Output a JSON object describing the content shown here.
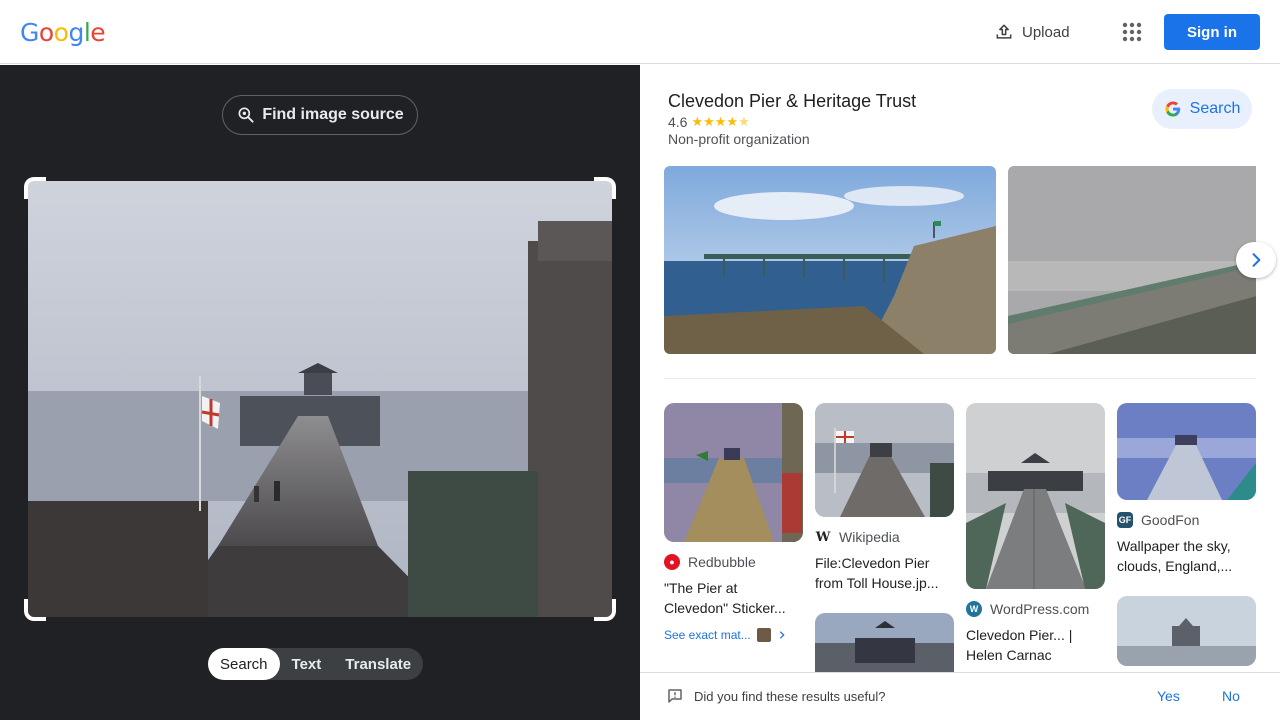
{
  "header": {
    "logo_letters": [
      "G",
      "o",
      "o",
      "g",
      "l",
      "e"
    ],
    "logo_colors": [
      "#4285f4",
      "#ea4335",
      "#fbbc05",
      "#4285f4",
      "#34a853",
      "#ea4335"
    ],
    "upload_label": "Upload",
    "apps_icon": "apps-grid-icon",
    "signin_label": "Sign in"
  },
  "left": {
    "find_source_label": "Find image source",
    "modes": [
      {
        "label": "Search",
        "active": true
      },
      {
        "label": "Text",
        "active": false
      },
      {
        "label": "Translate",
        "active": false
      }
    ]
  },
  "knowledge_panel": {
    "title": "Clevedon Pier & Heritage Trust",
    "rating": "4.6",
    "stars": 4.6,
    "type": "Non-profit organization",
    "search_label": "Search"
  },
  "results": [
    {
      "source": "Redbubble",
      "title": "\"The Pier at Clevedon\" Sticker...",
      "exact_label": "See exact mat..."
    },
    {
      "source": "Wikipedia",
      "title": "File:Clevedon Pier from Toll House.jp..."
    },
    {
      "source": "WordPress.com",
      "title": "Clevedon Pier... | Helen Carnac"
    },
    {
      "source": "GoodFon",
      "title": "Wallpaper the sky, clouds, England,..."
    }
  ],
  "feedback": {
    "question": "Did you find these results useful?",
    "yes": "Yes",
    "no": "No"
  },
  "colors": {
    "accent": "#1a73e8",
    "dark_bg": "#202124",
    "star": "#fbbc04"
  }
}
